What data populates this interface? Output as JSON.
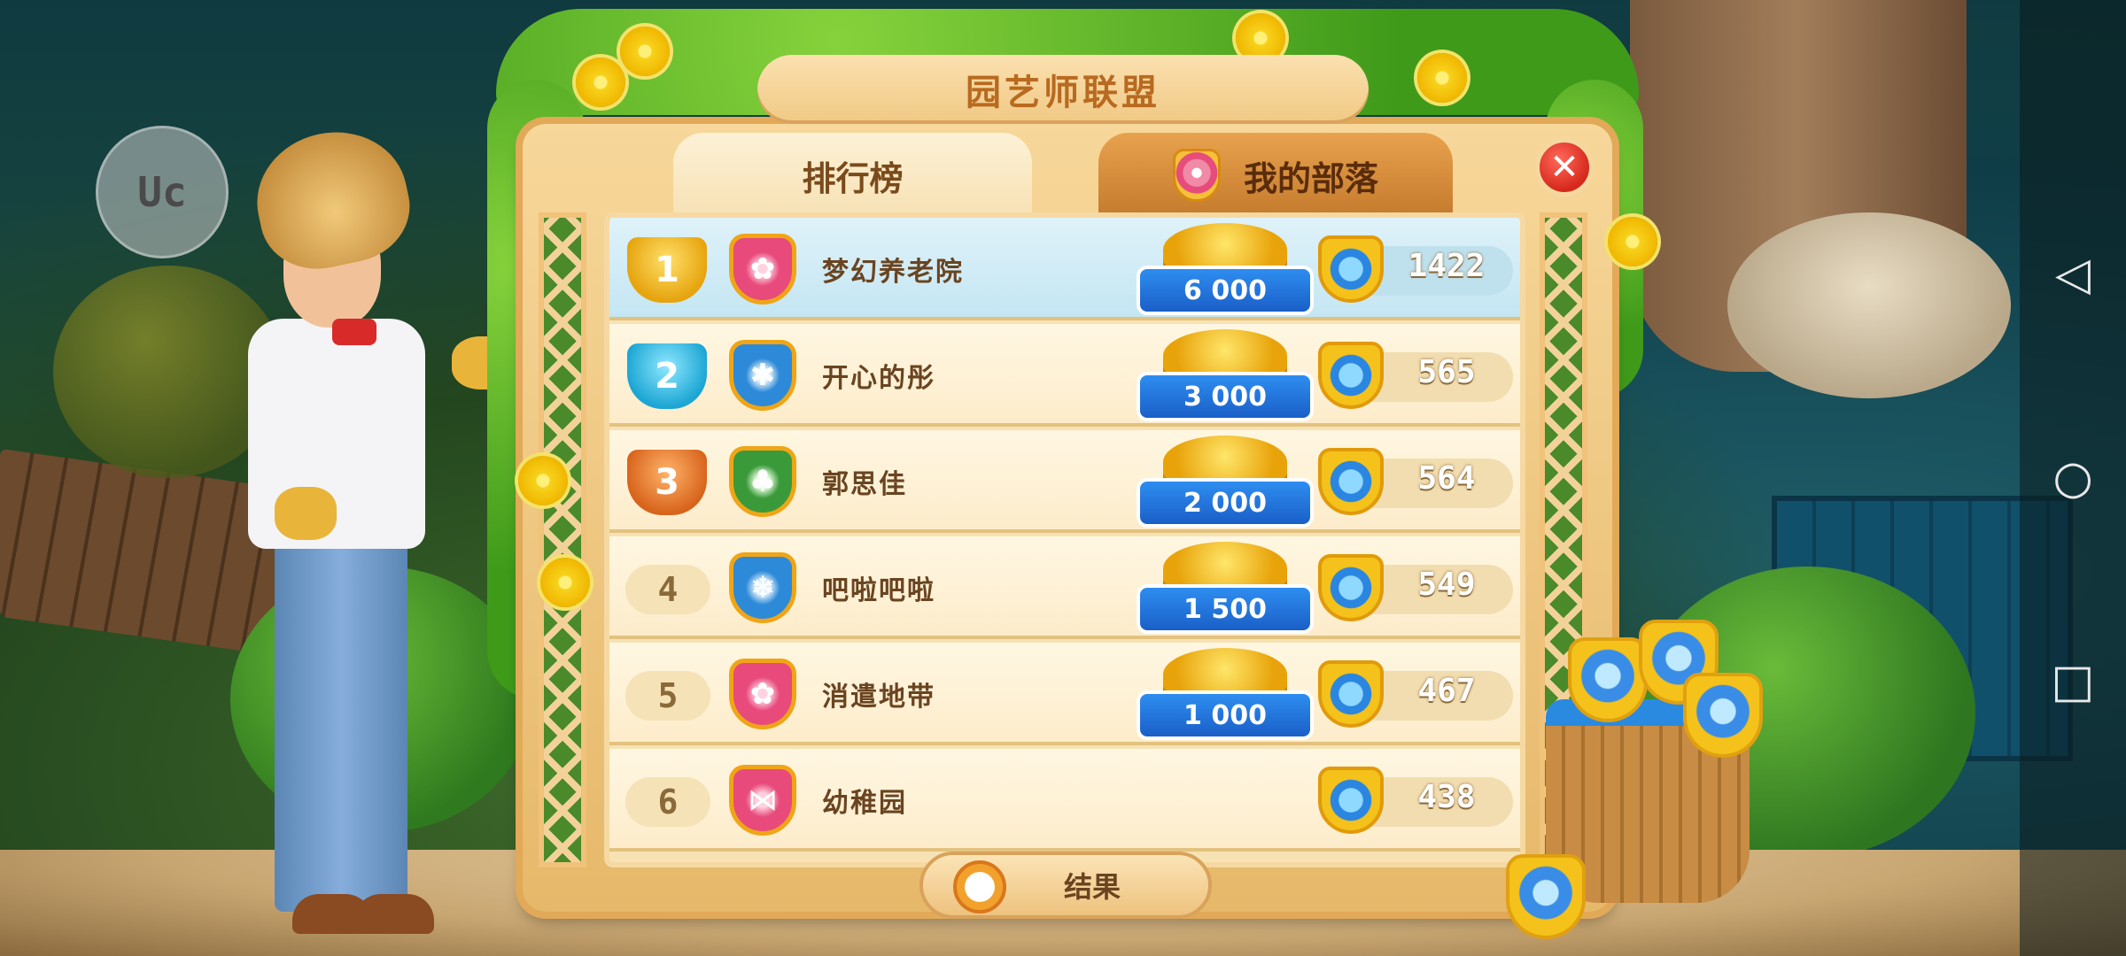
{
  "panel": {
    "title": "园艺师联盟"
  },
  "tabs": [
    {
      "label": "排行榜",
      "active": true
    },
    {
      "label": "我的部落",
      "active": false,
      "icon": "tribe-shield-icon"
    }
  ],
  "overlay": {
    "uc_label": "Uc"
  },
  "leaderboard": [
    {
      "rank": "1",
      "name": "梦幻养老院",
      "badge": "pink-flower",
      "reward": "6 000",
      "score": "1422",
      "highlight": true
    },
    {
      "rank": "2",
      "name": "开心的彤",
      "badge": "blue-paw",
      "reward": "3 000",
      "score": "565"
    },
    {
      "rank": "3",
      "name": "郭思佳",
      "badge": "green-clover",
      "reward": "2 000",
      "score": "564"
    },
    {
      "rank": "4",
      "name": "吧啦吧啦",
      "badge": "blue-snowflake",
      "reward": "1 500",
      "score": "549"
    },
    {
      "rank": "5",
      "name": "消遣地带",
      "badge": "pink-flower",
      "reward": "1 000",
      "score": "467"
    },
    {
      "rank": "6",
      "name": "幼稚园",
      "badge": "pink-bow",
      "reward": "",
      "score": "438"
    }
  ],
  "footer": {
    "results_label": "结果"
  },
  "colors": {
    "accent": "#e8a30a",
    "ribbon": "#1a5fc8",
    "highlight_row": "#c4e6f3",
    "close": "#d6281c"
  },
  "nav": {
    "back": "◁",
    "home": "○",
    "recent": "□"
  }
}
